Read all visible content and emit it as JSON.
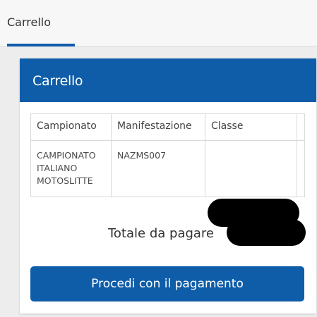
{
  "tab": {
    "label": "Carrello"
  },
  "card": {
    "title": "Carrello"
  },
  "table": {
    "headers": [
      "Campionato",
      "Manifestazione",
      "Classe"
    ],
    "rows": [
      {
        "campionato_lines": [
          "CAMPIONATO",
          "ITALIANO",
          "MOTOSLITTE"
        ],
        "manifestazione": "NAZMS007",
        "classe": ""
      }
    ]
  },
  "total": {
    "label": "Totale da pagare",
    "value": ""
  },
  "button": {
    "label": "Procedi con il pagamento"
  },
  "colors": {
    "primary": "#0f5da9",
    "background": "#ededed",
    "redaction": "#000000"
  }
}
